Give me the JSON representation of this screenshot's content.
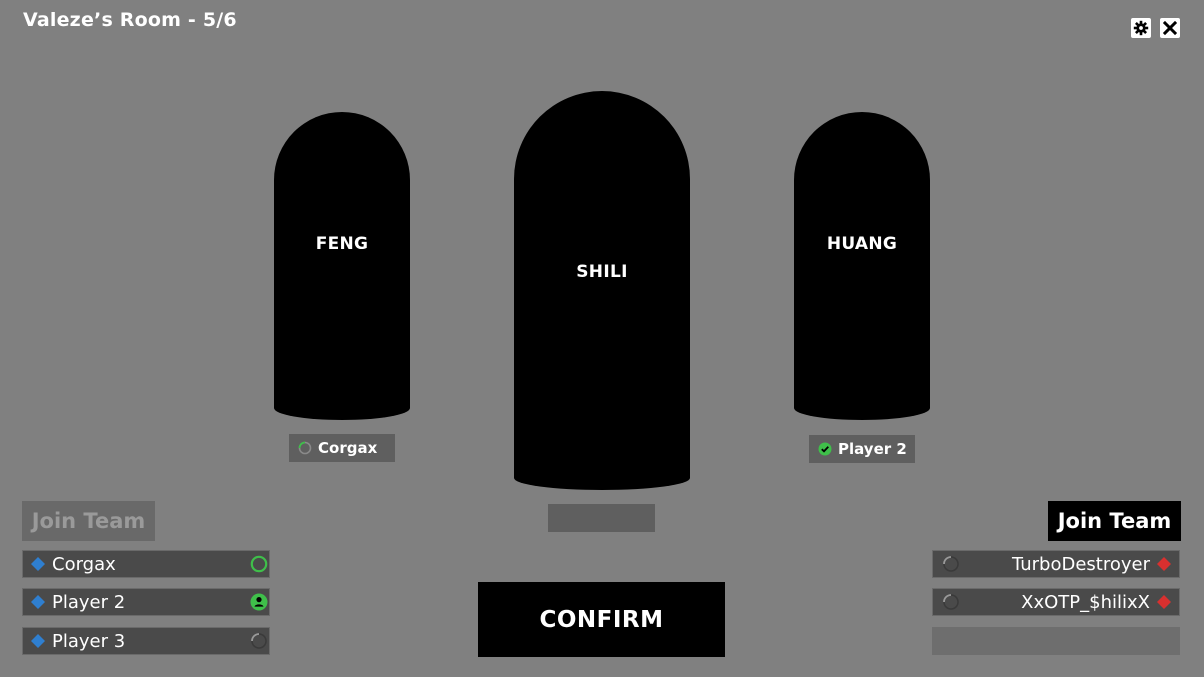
{
  "room": {
    "title": "Valeze’s Room - 5/6"
  },
  "icons": {
    "settings": "gear-icon",
    "close": "close-icon"
  },
  "characters": [
    {
      "name": "FENG",
      "selected_by": "Corgax",
      "selected_status": "loading"
    },
    {
      "name": "SHILI",
      "selected_by": "",
      "selected_status": ""
    },
    {
      "name": "HUANG",
      "selected_by": "Player 2",
      "selected_status": "confirmed"
    }
  ],
  "left_team": {
    "join_label": "Join Team",
    "join_enabled": false,
    "marker_color": "#2f7fd0",
    "players": [
      {
        "name": "Corgax",
        "status": "ring"
      },
      {
        "name": "Player 2",
        "status": "person"
      },
      {
        "name": "Player 3",
        "status": "loading"
      }
    ]
  },
  "right_team": {
    "join_label": "Join Team",
    "join_enabled": true,
    "marker_color": "#d8302f",
    "players": [
      {
        "name": "TurboDestroyer",
        "status": "loading"
      },
      {
        "name": "XxOTP_$hilixX",
        "status": "loading"
      }
    ],
    "empty_slots": 1
  },
  "confirm": {
    "label": "CONFIRM"
  },
  "colors": {
    "status_green": "#3fbf4a",
    "background": "#808080"
  }
}
